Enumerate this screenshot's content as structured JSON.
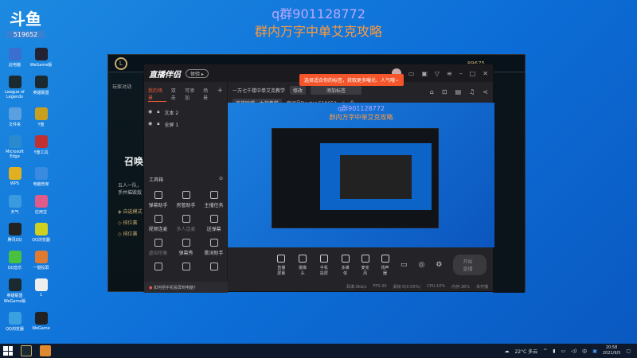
{
  "watermark": {
    "line1": "q群901128772",
    "line2": "群内万字中单艾克攻略"
  },
  "logo": {
    "text": "斗鱼",
    "room": "519652"
  },
  "desktop_icons": [
    "此电脑",
    "WeGame版",
    "League of Legends",
    "英雄联盟",
    "文件夹",
    "Y盘",
    "Microsoft Edge",
    "Y盘工具",
    "WPS",
    "电脑管家",
    "天气",
    "应用宝",
    "腾讯QQ",
    "QQ浏览器",
    "QQ音乐",
    "一键投屏",
    "英雄联盟 WeGame版",
    "1",
    "QQ浏览器",
    "WeGame"
  ],
  "lol": {
    "nav": "玩家对战",
    "title": "召唤",
    "desc1": "五人一队，",
    "desc2": "手并摧毁敌",
    "modes": [
      "自选模式",
      "排位赛",
      "排位赛"
    ],
    "currency": "89675"
  },
  "app": {
    "brand": "直播伴侣",
    "version_pill": "体验 ▸",
    "tooltip": "选择适合你的标签，获取更多曝光、人气哦~",
    "tabs": [
      "我的场景",
      "双击",
      "可添加",
      "场景"
    ],
    "sources": [
      "文本 2",
      "全屏 1"
    ],
    "stream_title": "一万七千楼中单艾克教学",
    "edit_tag": "修改",
    "tag_field": "添加标签",
    "category": "英雄联盟 · 大神教学",
    "room_id": "房间号Dexter 519652",
    "heat": "0",
    "tools_title": "工具箱",
    "tools": [
      "弹幕助手",
      "房管助手",
      "主播任务",
      "视频连麦",
      "多人连麦",
      "送弹幕",
      "虚拟形象",
      "弹幕秀",
      "歌词助手",
      "",
      "",
      ""
    ],
    "notice": "如何把手机投屏到电脑？",
    "preview": {
      "line1": "q群901128772",
      "line2": "群内万字中单艾克攻略"
    },
    "toolbar": [
      "直播屏幕",
      "摄像头",
      "手机投屏",
      "多媒体",
      "麦克风",
      "扬声器"
    ],
    "go_live": "开始直播",
    "status": [
      "码率:0kb/s",
      "FPS:30",
      "丢帧:0(0.00%)",
      "CPU:10%",
      "内存:36%",
      "未开播"
    ]
  },
  "taskbar": {
    "weather": "22°C 多云",
    "time": "20:58",
    "date": "2021/9/5",
    "ime": "中"
  }
}
